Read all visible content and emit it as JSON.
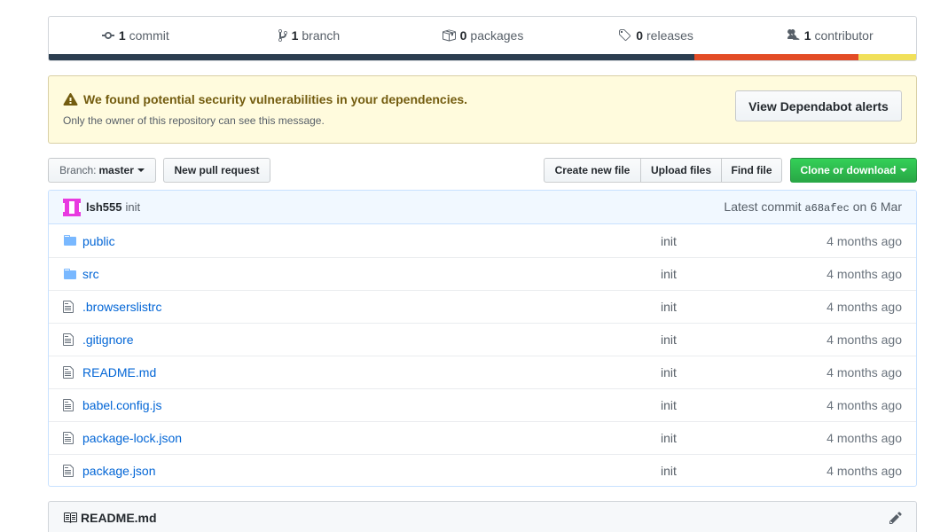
{
  "stats": {
    "commits": {
      "count": "1",
      "label": "commit"
    },
    "branches": {
      "count": "1",
      "label": "branch"
    },
    "packages": {
      "count": "0",
      "label": "packages"
    },
    "releases": {
      "count": "0",
      "label": "releases"
    },
    "contributors": {
      "count": "1",
      "label": "contributor"
    }
  },
  "languages": [
    {
      "color": "#2c3e50",
      "share": 0.744
    },
    {
      "color": "#e34c26",
      "share": 0.19
    },
    {
      "color": "#f1e05a",
      "share": 0.066
    }
  ],
  "alert": {
    "title": "We found potential security vulnerabilities in your dependencies.",
    "subtitle": "Only the owner of this repository can see this message.",
    "button": "View Dependabot alerts"
  },
  "toolbar": {
    "branch_prefix": "Branch:",
    "branch_name": "master",
    "new_pr": "New pull request",
    "create_file": "Create new file",
    "upload_files": "Upload files",
    "find_file": "Find file",
    "clone": "Clone or download"
  },
  "commit": {
    "author": "lsh555",
    "message": "init",
    "latest_prefix": "Latest commit",
    "sha": "a68afec",
    "date": "on 6 Mar"
  },
  "files": [
    {
      "name": "public",
      "type": "dir",
      "message": "init",
      "age": "4 months ago"
    },
    {
      "name": "src",
      "type": "dir",
      "message": "init",
      "age": "4 months ago"
    },
    {
      "name": ".browserslistrc",
      "type": "file",
      "message": "init",
      "age": "4 months ago"
    },
    {
      "name": ".gitignore",
      "type": "file",
      "message": "init",
      "age": "4 months ago"
    },
    {
      "name": "README.md",
      "type": "file",
      "message": "init",
      "age": "4 months ago"
    },
    {
      "name": "babel.config.js",
      "type": "file",
      "message": "init",
      "age": "4 months ago"
    },
    {
      "name": "package-lock.json",
      "type": "file",
      "message": "init",
      "age": "4 months ago"
    },
    {
      "name": "package.json",
      "type": "file",
      "message": "init",
      "age": "4 months ago"
    }
  ],
  "readme": {
    "title": "README.md"
  },
  "colors": {
    "link": "#0366d6",
    "green": "#28a745",
    "alert_bg": "#fffbdd"
  }
}
